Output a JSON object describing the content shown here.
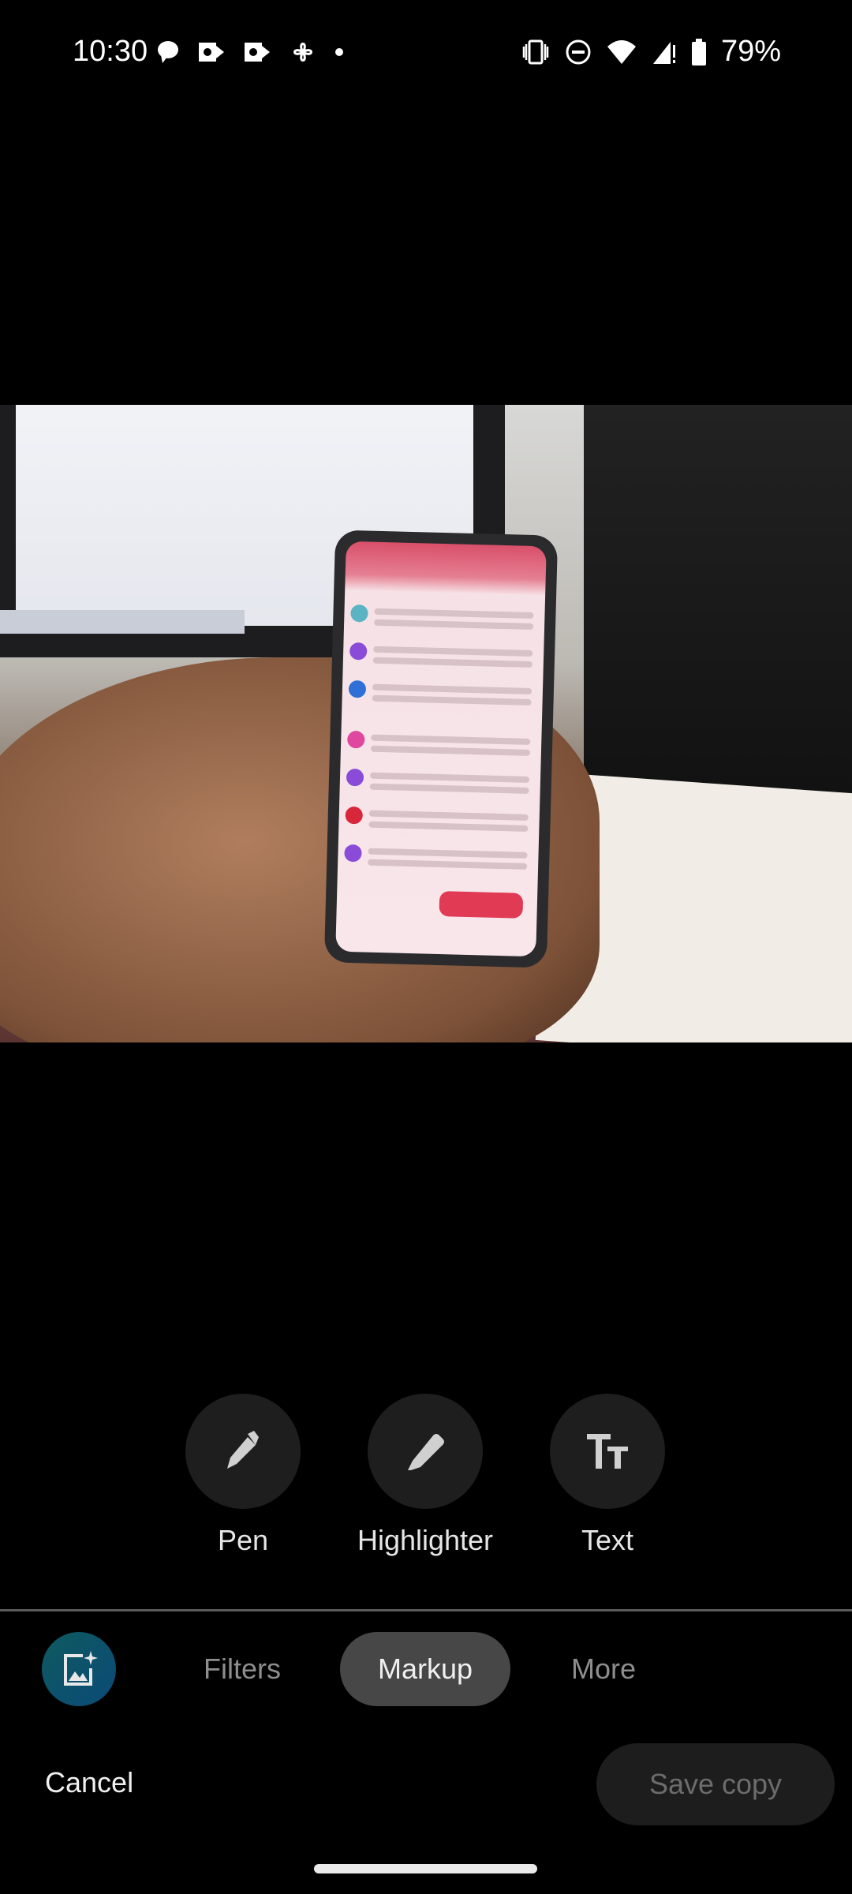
{
  "status_bar": {
    "time": "10:30",
    "battery": "79%",
    "left_icons": [
      "chat-bubble-icon",
      "outlook-icon",
      "outlook-icon",
      "pinwheel-icon",
      "dot-icon"
    ],
    "right_icons": [
      "vibrate-icon",
      "do-not-disturb-icon",
      "wifi-icon",
      "signal-icon",
      "battery-icon"
    ]
  },
  "markup_tools": [
    {
      "label": "Pen",
      "icon": "pen-icon"
    },
    {
      "label": "Highlighter",
      "icon": "highlighter-icon"
    },
    {
      "label": "Text",
      "icon": "text-format-icon"
    }
  ],
  "tabs": {
    "ai_icon": "magic-image-icon",
    "items": [
      {
        "label": "Filters",
        "active": false
      },
      {
        "label": "Markup",
        "active": true
      },
      {
        "label": "More",
        "active": false
      }
    ]
  },
  "actions": {
    "cancel": "Cancel",
    "save_copy": "Save copy"
  },
  "colors": {
    "background": "#000000",
    "tool_circle": "#1e1e1e",
    "active_tab": "#474747",
    "ai_button": "#0e5a6e"
  }
}
